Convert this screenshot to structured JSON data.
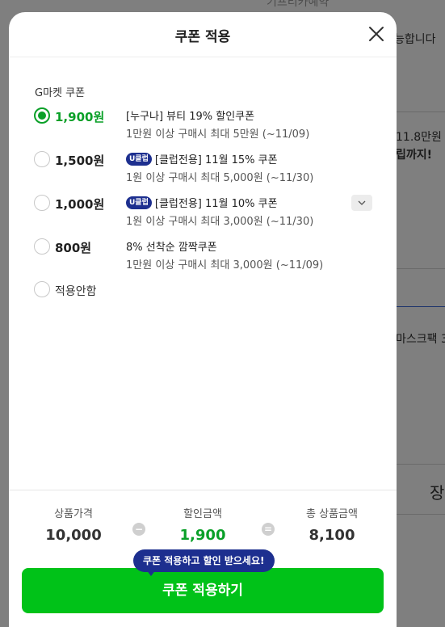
{
  "background": {
    "top_text": "기프티카예약",
    "notice_text": "능합니다",
    "price_text": "11.8만원",
    "promo_text": "립까지!",
    "product_text": "마스크팩 30",
    "side_button": "장"
  },
  "modal": {
    "title": "쿠폰 적용",
    "section_label": "G마켓 쿠폰",
    "coupons": [
      {
        "amount": "1,900원",
        "badge": "",
        "title": "[누구나] 뷰티 19% 할인쿠폰",
        "sub": "1만원 이상 구매시 최대 5만원 (~11/09)"
      },
      {
        "amount": "1,500원",
        "badge": "U클럽",
        "title": "[클럽전용] 11월 15% 쿠폰",
        "sub": "1원 이상 구매시 최대 5,000원 (~11/30)"
      },
      {
        "amount": "1,000원",
        "badge": "U클럽",
        "title": "[클럽전용] 11월 10% 쿠폰",
        "sub": "1원 이상 구매시 최대 3,000원 (~11/30)"
      },
      {
        "amount": "800원",
        "badge": "",
        "title": "8% 선착순 깜짝쿠폰",
        "sub": "1만원 이상 구매시 최대 3,000원 (~11/09)"
      }
    ],
    "none_label": "적용안함",
    "summary": {
      "price_label": "상품가격",
      "price_value": "10,000",
      "minus_symbol": "−",
      "discount_label": "할인금액",
      "discount_value": "1,900",
      "equals_symbol": "=",
      "total_label": "총 상품금액",
      "total_value": "8,100"
    },
    "tooltip": "쿠폰 적용하고 할인 받으세요!",
    "apply_label": "쿠폰 적용하기"
  },
  "colors": {
    "accent": "#0aa028",
    "button": "#00c218",
    "badge": "#1d2f8f"
  },
  "icons": {
    "close": "close-icon",
    "expand": "chevron-down-icon"
  }
}
